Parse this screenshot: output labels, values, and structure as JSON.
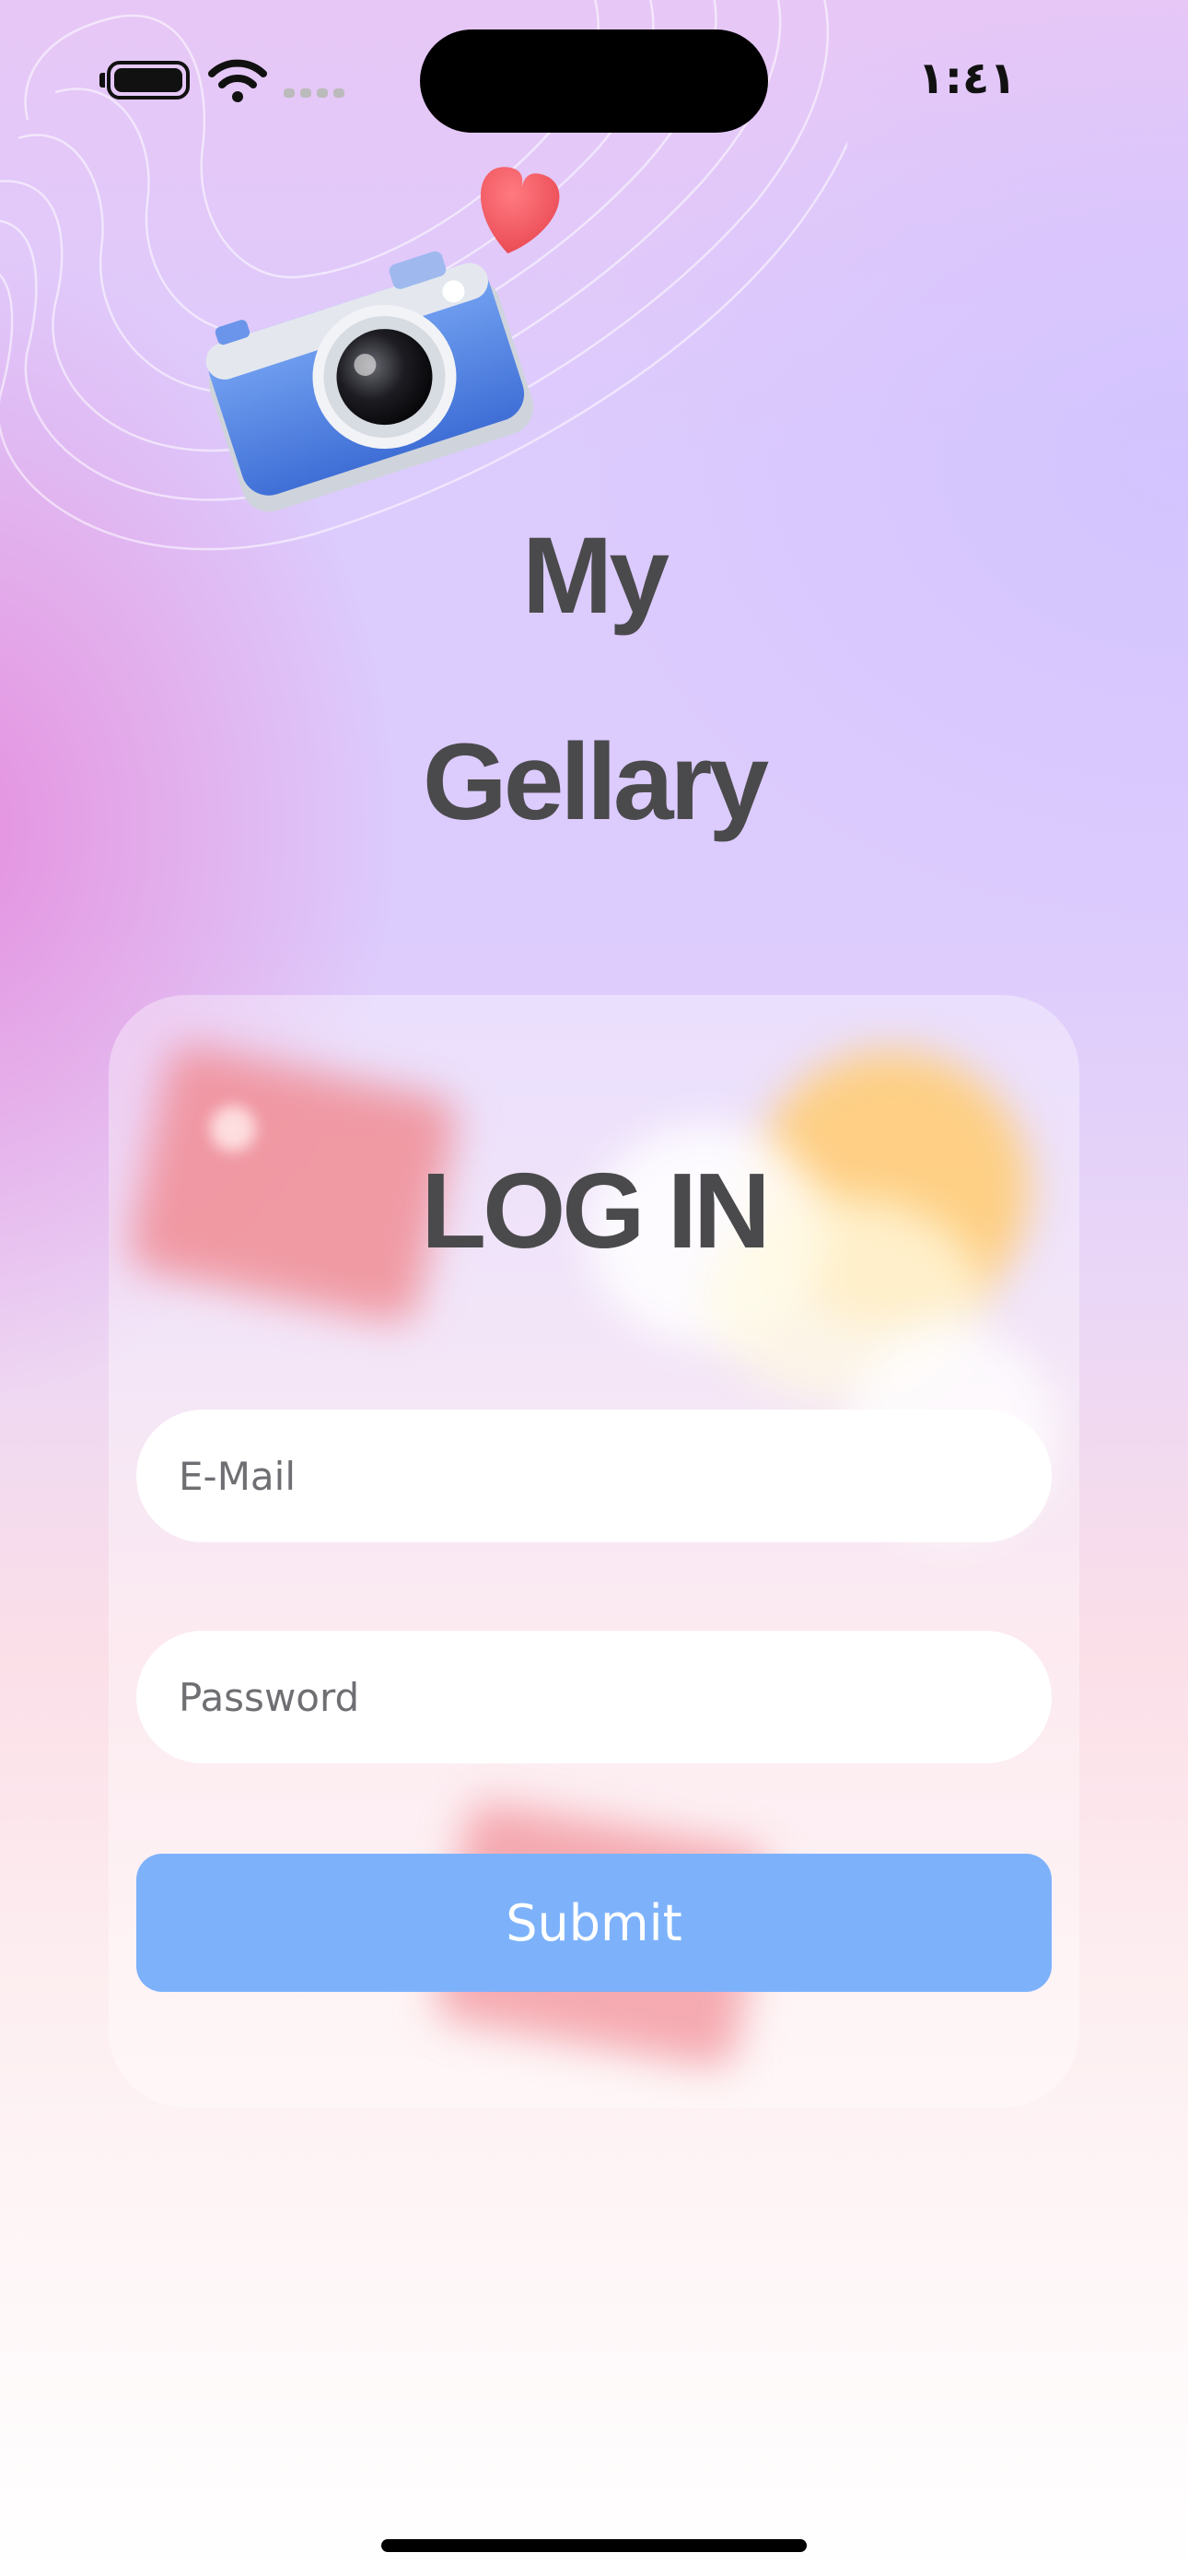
{
  "status_bar": {
    "time": "١:٤١",
    "icons": [
      "battery-icon",
      "wifi-icon",
      "signal-icon"
    ]
  },
  "illustration": {
    "icons": [
      "camera-icon",
      "heart-icon"
    ]
  },
  "header": {
    "title_line_1": "My",
    "title_line_2": "Gellary"
  },
  "login": {
    "title": "LOG IN",
    "email_placeholder": "E-Mail",
    "email_value": "",
    "password_placeholder": "Password",
    "password_value": "",
    "submit_label": "Submit"
  },
  "colors": {
    "title_text": "#4a4a4c",
    "submit_button": "#7db2fb",
    "card_background": "rgba(255,255,255,0.36)",
    "background_pink": "#e896de",
    "background_lavender": "#dccbfd"
  }
}
